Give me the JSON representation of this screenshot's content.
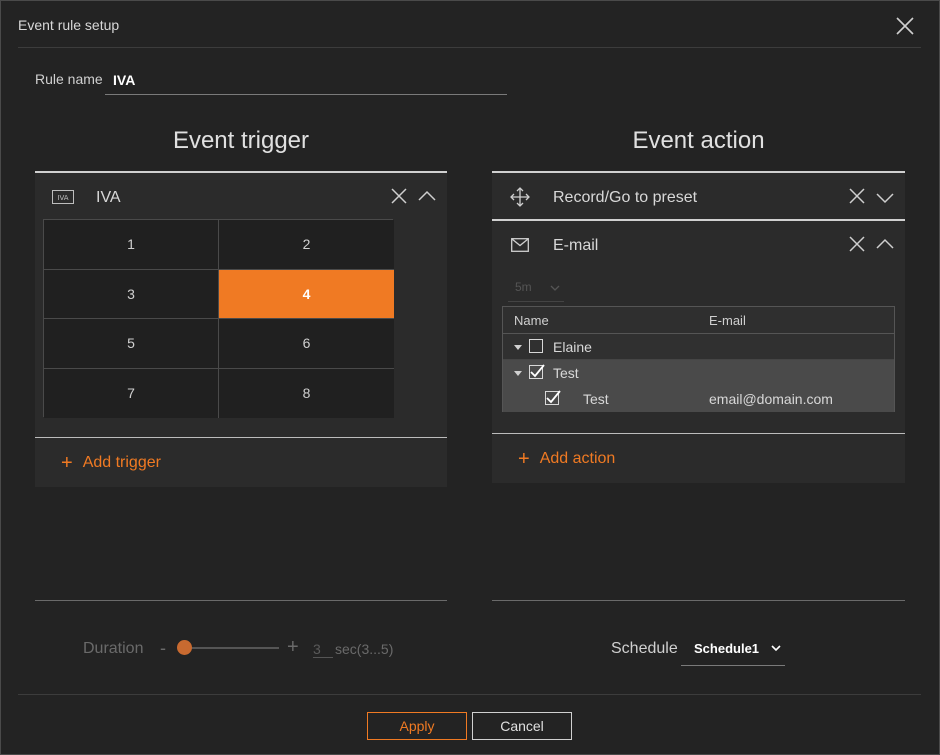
{
  "dialog": {
    "title": "Event rule setup"
  },
  "rule": {
    "label": "Rule name",
    "value": "IVA"
  },
  "trigger": {
    "section_title": "Event trigger",
    "item": {
      "icon_text": "IVA",
      "label": "IVA"
    },
    "grid": [
      "1",
      "2",
      "3",
      "4",
      "5",
      "6",
      "7",
      "8"
    ],
    "selected": "4",
    "add_label": "Add trigger"
  },
  "action": {
    "section_title": "Event action",
    "items": [
      {
        "label": "Record/Go to preset",
        "icon": "move-icon"
      },
      {
        "label": "E-mail",
        "icon": "mail-icon"
      }
    ],
    "interval_value": "5m",
    "table": {
      "headers": [
        "Name",
        "E-mail"
      ],
      "rows": [
        {
          "name": "Elaine",
          "email": "",
          "checked": false,
          "group": true
        },
        {
          "name": "Test",
          "email": "",
          "checked": true,
          "group": true
        },
        {
          "name": "Test",
          "email": "email@domain.com",
          "checked": true,
          "group": false
        }
      ]
    },
    "add_label": "Add action"
  },
  "duration": {
    "label": "Duration",
    "minus": "-",
    "plus": "+",
    "value": "3",
    "unit": "sec(3...5)"
  },
  "schedule": {
    "label": "Schedule",
    "value": "Schedule1"
  },
  "buttons": {
    "apply": "Apply",
    "cancel": "Cancel"
  },
  "colors": {
    "accent": "#f07a23",
    "background": "#232323",
    "panel": "#2b2b2b"
  }
}
